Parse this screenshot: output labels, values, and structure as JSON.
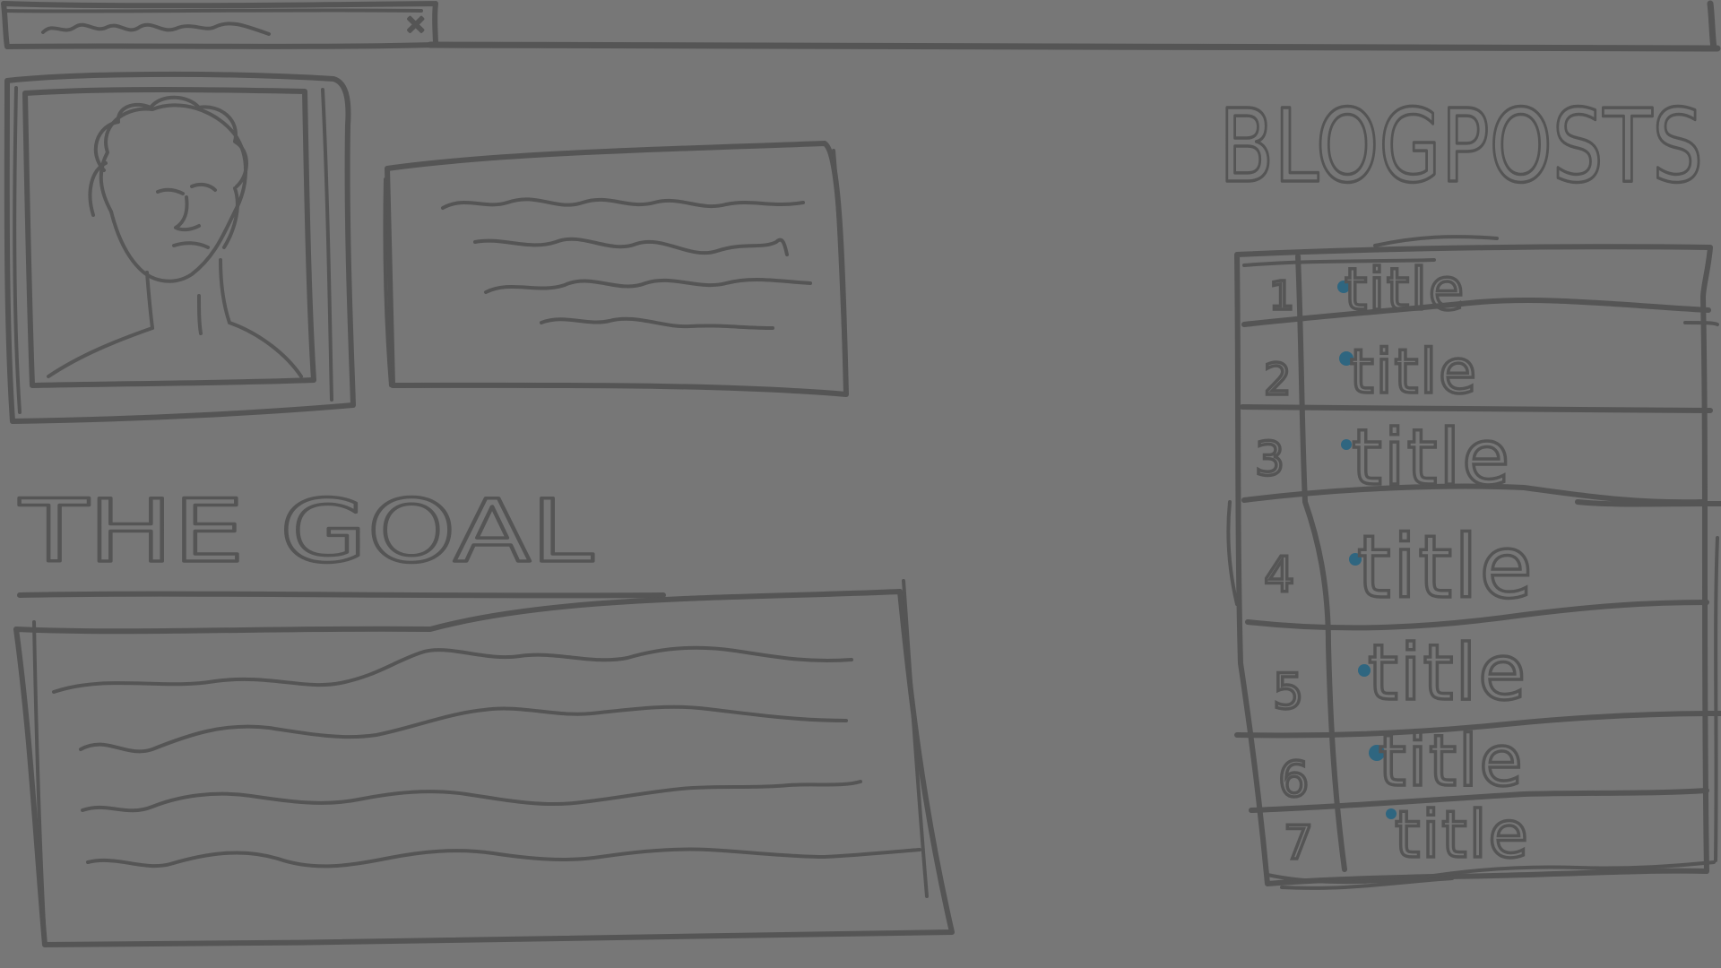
{
  "tab": {
    "label_hint": "",
    "close_glyph": "×"
  },
  "headings": {
    "goal": "THE  GOAL",
    "blogposts": "BLOGPOSTS"
  },
  "blogposts": {
    "items": [
      {
        "number": "1",
        "title": "title"
      },
      {
        "number": "2",
        "title": "title"
      },
      {
        "number": "3",
        "title": "title"
      },
      {
        "number": "4",
        "title": "title"
      },
      {
        "number": "5",
        "title": "title"
      },
      {
        "number": "6",
        "title": "title"
      },
      {
        "number": "7",
        "title": "title"
      }
    ]
  },
  "colors": {
    "background": "#777777",
    "ink": "#555555",
    "bullet": "#2f6680"
  },
  "icons": {
    "avatar": "portrait-sketch-icon",
    "close": "close-icon"
  }
}
